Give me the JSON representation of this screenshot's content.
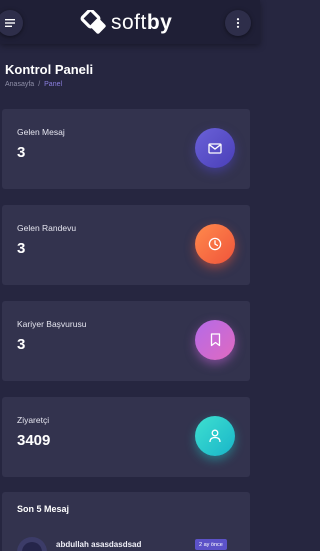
{
  "header": {
    "logo_text_regular": "soft",
    "logo_text_bold": "by",
    "menu_icon": "hamburger-icon",
    "more_icon": "vertical-dots-icon"
  },
  "page": {
    "title": "Kontrol Paneli",
    "breadcrumb": [
      "Anasayfa",
      "Panel"
    ],
    "breadcrumb_separator": "/"
  },
  "stats": [
    {
      "label": "Gelen Mesaj",
      "value": "3",
      "icon": "envelope-icon",
      "color": "#5a50c8"
    },
    {
      "label": "Gelen Randevu",
      "value": "3",
      "icon": "clock-icon",
      "color": "#f76b42"
    },
    {
      "label": "Kariyer Başvurusu",
      "value": "3",
      "icon": "bookmark-icon",
      "color": "#c86ad8"
    },
    {
      "label": "Ziyaretçi",
      "value": "3409",
      "icon": "user-icon",
      "color": "#22c6cc"
    }
  ],
  "messages": {
    "title": "Son 5 Mesaj",
    "items": [
      {
        "name": "abdullah asasdasdsad",
        "time": "2 ay önce"
      }
    ]
  },
  "colors": {
    "background": "#262640",
    "card": "#33334e",
    "topbar": "#1f1f36",
    "accent": "#8b7fe0"
  }
}
